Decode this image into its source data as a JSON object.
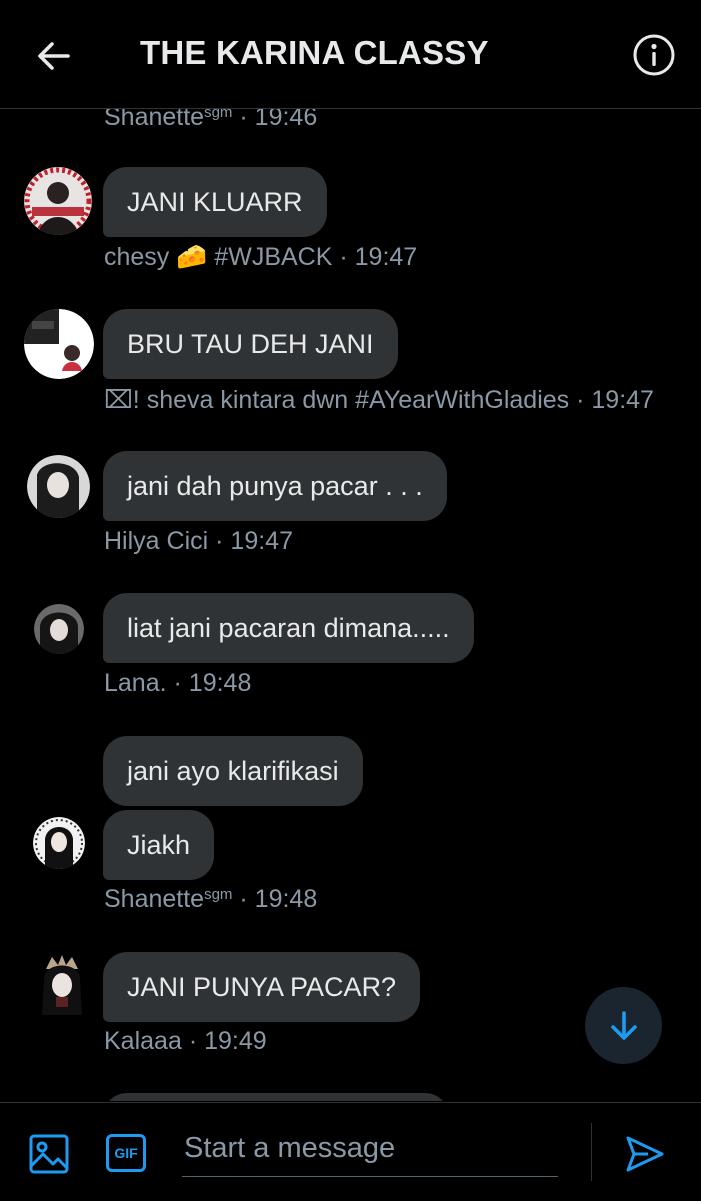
{
  "header": {
    "title": "THE KARINA CLASSY",
    "back_icon": "arrow-left-icon",
    "info_icon": "info-circle-icon"
  },
  "messages": [
    {
      "sender": "Shanette",
      "sender_suffix": "sgm",
      "time": "· 19:46"
    },
    {
      "text": "JANI KLUARR",
      "sender": "chesy 🧀 #WJBACK",
      "time": "· 19:47"
    },
    {
      "text": "BRU TAU DEH JANI",
      "sender": "⌧! sheva kintara dwn #AYearWithGladies",
      "time": "· 19:47"
    },
    {
      "text": "jani dah punya pacar . . .",
      "sender": "Hilya Cici",
      "time": "· 19:47"
    },
    {
      "text": "liat jani pacaran dimana.....",
      "sender": "Lana.",
      "time": "· 19:48"
    },
    {
      "text": "jani ayo klarifikasi"
    },
    {
      "text": "Jiakh",
      "sender": "Shanette",
      "sender_suffix": "sgm",
      "time": "· 19:48"
    },
    {
      "text": "JANI PUNYA PACAR?",
      "sender": "Kalaaa",
      "time": "· 19:49"
    }
  ],
  "scroll_down_icon": "arrow-down-icon",
  "composer": {
    "placeholder": "Start a message",
    "gif_label": "GIF",
    "media_icon": "image-icon",
    "send_icon": "send-icon"
  },
  "colors": {
    "background": "#000000",
    "bubble": "#2f3336",
    "meta_text": "#8b98a5",
    "accent": "#1d9bf0"
  }
}
